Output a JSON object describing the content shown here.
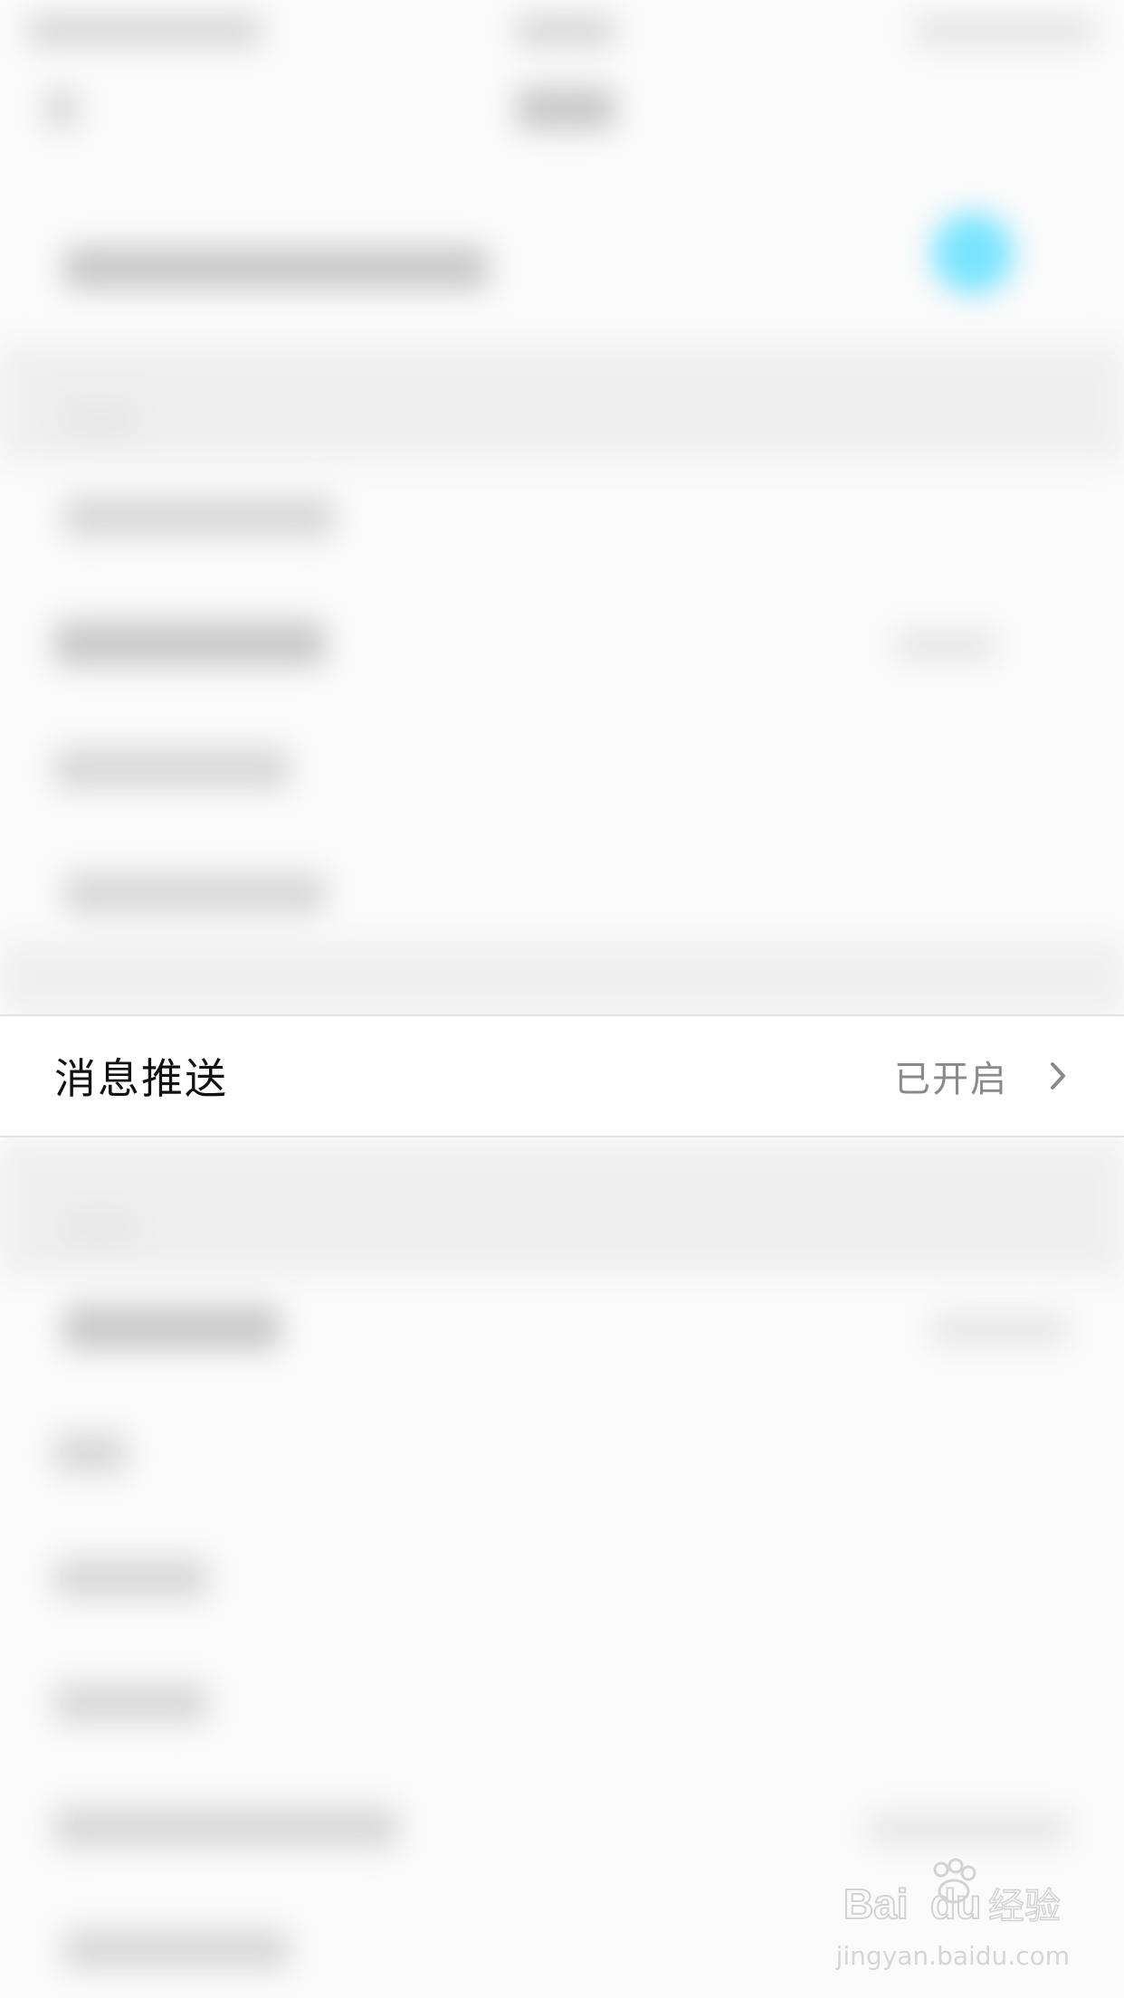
{
  "settings_row": {
    "label": "消息推送",
    "status": "已开启",
    "chevron_icon": "chevron-right-icon"
  },
  "watermark": {
    "logo_text": "Baidu经验",
    "url": "jingyan.baidu.com"
  },
  "colors": {
    "background": "#fbfbfb",
    "row_background": "#ffffff",
    "label_text": "#111111",
    "status_text": "#8a8a8a",
    "divider": "#e2e2e2",
    "accent_cyan": "#79e4ff"
  }
}
